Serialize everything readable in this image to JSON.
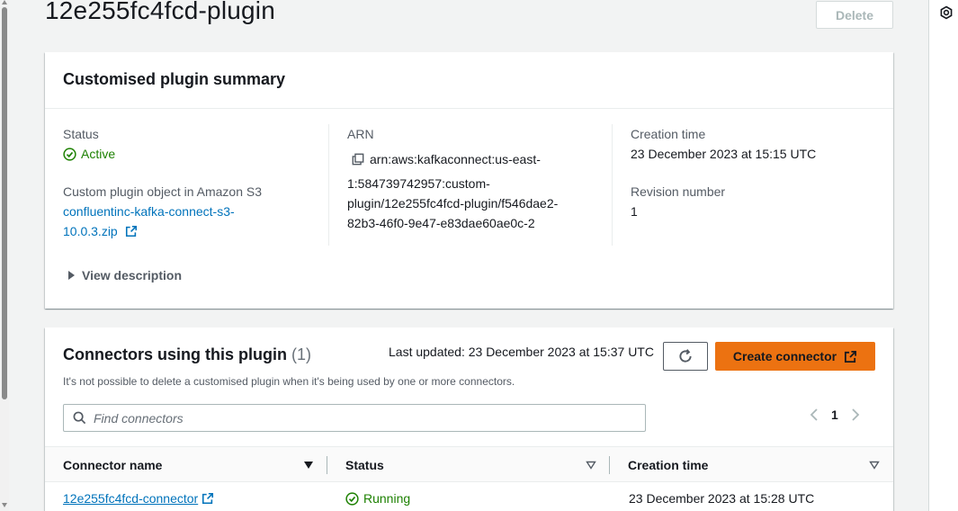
{
  "page": {
    "title": "12e255fc4fcd-plugin",
    "delete_label": "Delete"
  },
  "summary": {
    "heading": "Customised plugin summary",
    "status_label": "Status",
    "status_value": "Active",
    "s3_label": "Custom plugin object in Amazon S3",
    "s3_link_line1": "confluentinc-kafka-connect-s3-",
    "s3_link_line2": "10.0.3.zip",
    "arn_label": "ARN",
    "arn_line1": "arn:aws:kafkaconnect:us-east-",
    "arn_line2": "1:584739742957:custom-",
    "arn_line3": "plugin/12e255fc4fcd-plugin/f546dae2-",
    "arn_line4": "82b3-46f0-9e47-e83dae60ae0c-2",
    "creation_label": "Creation time",
    "creation_value": "23 December 2023 at 15:15 UTC",
    "revision_label": "Revision number",
    "revision_value": "1",
    "view_description": "View description"
  },
  "connectors": {
    "heading": "Connectors using this plugin",
    "count": "(1)",
    "subtitle": "It's not possible to delete a customised plugin when it's being used by one or more connectors.",
    "last_updated": "Last updated: 23 December 2023 at 15:37 UTC",
    "create_label": "Create connector",
    "search_placeholder": "Find connectors",
    "page_number": "1",
    "columns": {
      "name": "Connector name",
      "status": "Status",
      "creation": "Creation time"
    },
    "rows": [
      {
        "name": "12e255fc4fcd-connector",
        "status": "Running",
        "creation": "23 December 2023 at 15:28 UTC"
      }
    ]
  },
  "colors": {
    "accent": "#ec7211",
    "link": "#0073bb",
    "success": "#1d8102"
  },
  "icons": [
    "settings-icon",
    "check-circle-icon",
    "external-link-icon",
    "copy-icon",
    "caret-right-icon",
    "refresh-icon",
    "search-icon",
    "chevron-left-icon",
    "chevron-right-icon",
    "sort-down-icon"
  ]
}
